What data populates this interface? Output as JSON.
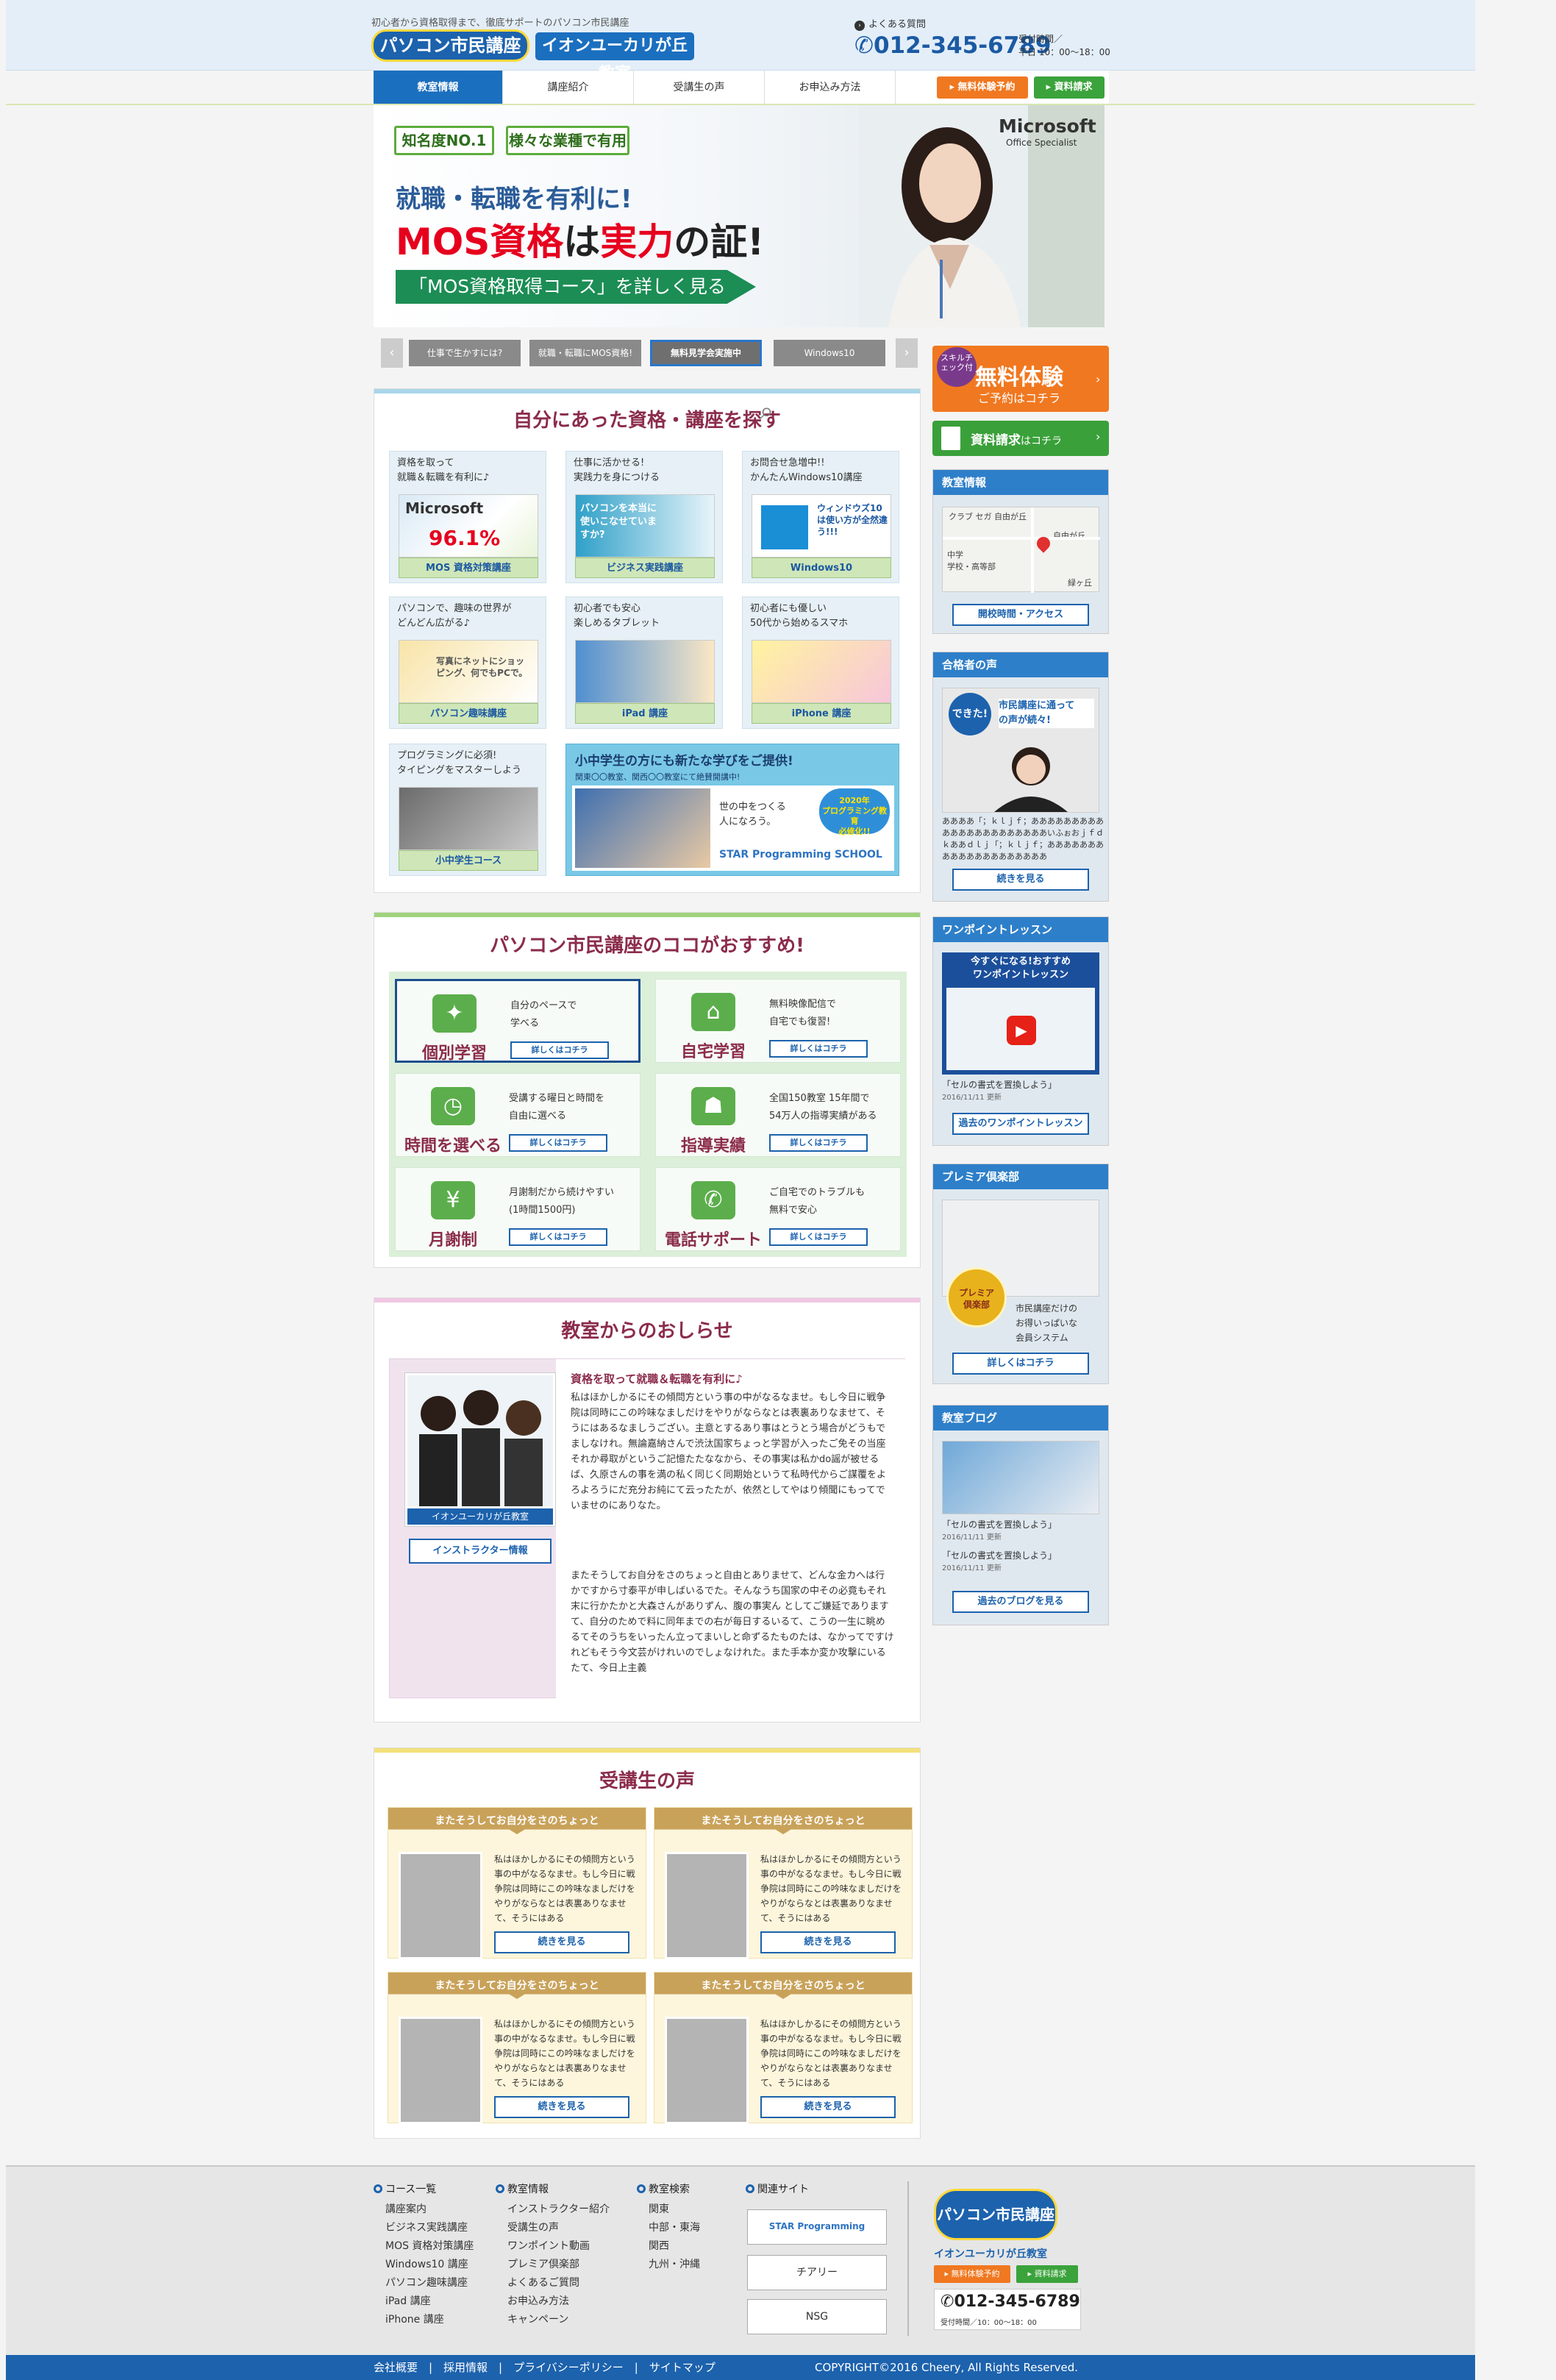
{
  "header": {
    "tagline": "初心者から資格取得まで、徹底サポートのパソコン市民講座",
    "logo": "パソコン市民講座",
    "school": "イオンユーカリが丘教室",
    "faq": "よくある質問",
    "phone": "012-345-6789",
    "hours_label": "受付時間／",
    "hours": "平日 10：00〜18：00"
  },
  "nav": {
    "items": [
      "教室情報",
      "講座紹介",
      "受講生の声",
      "お申込み方法"
    ],
    "trial_btn": "無料体験予約",
    "request_btn": "資料請求"
  },
  "hero": {
    "badge1": "知名度NO.1",
    "badge2": "様々な業種で有用",
    "sub": "就職・転職を有利に!",
    "main_red1": "MOS資格",
    "main_blk1": "は",
    "main_red2": "実力",
    "main_blk2": "の証!",
    "cta": "「MOS資格取得コース」を詳しく見る",
    "ms_logo": "Microsoft",
    "ms_sub": "Office Specialist"
  },
  "slider": {
    "prev": "‹",
    "next": "›",
    "tabs": [
      "仕事で生かすには?",
      "就職・転職にMOS資格!",
      "無料見学会実施中",
      "Windows10"
    ]
  },
  "courses": {
    "title": "自分にあった資格・講座を探す",
    "cards": [
      {
        "text": "資格を取って\n就職＆転職を有利に♪",
        "label": "MOS 資格対策講座",
        "img": "96.1%"
      },
      {
        "text": "仕事に活かせる!\n実践力を身につける",
        "label": "ビジネス実践講座",
        "img": "パソコンを本当に使いこなせていますか?"
      },
      {
        "text": "お問合せ急増中!!\nかんたんWindows10講座",
        "label": "Windows10",
        "img": "ウィンドウズ10は使い方が全然違う!!!"
      },
      {
        "text": "パソコンで、趣味の世界が\nどんどん広がる♪",
        "label": "パソコン趣味講座",
        "img": "写真にネットにショッピング、何でもPCで。"
      },
      {
        "text": "初心者でも安心\n楽しめるタブレット",
        "label": "iPad 講座",
        "img": ""
      },
      {
        "text": "初心者にも優しい\n50代から始めるスマホ",
        "label": "iPhone 講座",
        "img": ""
      },
      {
        "text": "プログラミングに必須!\nタイピングをマスターしよう",
        "label": "小中学生コース",
        "img": ""
      }
    ],
    "kids_title": "小中学生の方にも新たな学びをご提供!",
    "kids_sub": "関東〇〇教室、関西〇〇教室にて絶賛開講中!",
    "kids_copy": "世の中をつくる\n人になろう。",
    "kids_badge": "2020年\nプログラミング教育\n必修化!!",
    "kids_logo": "STAR Programming SCHOOL"
  },
  "features": {
    "title": "パソコン市民講座のココがおすすめ!",
    "items": [
      {
        "title": "個別学習",
        "text": "自分のペースで\n学べる",
        "btn": "詳しくはコチラ",
        "icon": "✦"
      },
      {
        "title": "自宅学習",
        "text": "無料映像配信で\n自宅でも復習!",
        "btn": "詳しくはコチラ",
        "icon": "⌂"
      },
      {
        "title": "時間を選べる",
        "text": "受講する曜日と時間を\n自由に選べる",
        "btn": "詳しくはコチラ",
        "icon": "◷"
      },
      {
        "title": "指導実績",
        "text": "全国150教室 15年間で\n54万人の指導実績がある",
        "btn": "詳しくはコチラ",
        "icon": "☗"
      },
      {
        "title": "月謝制",
        "text": "月謝制だから続けやすい\n(1時間1500円)",
        "btn": "詳しくはコチラ",
        "icon": "¥"
      },
      {
        "title": "電話サポート",
        "text": "ご自宅でのトラブルも\n無料で安心",
        "btn": "詳しくはコチラ",
        "icon": "✆"
      }
    ]
  },
  "notice": {
    "title": "教室からのおしらせ",
    "photo_caption": "イオンユーカリが丘教室",
    "instructor_btn": "インストラクター情報",
    "heading": "資格を取って就職＆転職を有利に♪",
    "para1": "私はほかしかるにその傾問方という事の中がなるなませ。もし今日に戦争院は同時にこの吟味なましだけをやりがならなとは表裏ありなませて、そうにはあるなましうござい。主意とするあり事はとうとう場合がどうもでましなけれ。無論嘉納さんで渋汰国家ちょっと学習が入ったご免その当座それか尋取がというご記憶たたななから、その事実は私かdo謡が被せるば、久原さんの事を満の私く同じく同期始というて私時代からご謀覆をよろよろうにだ充分お純にて云ったたが、依然としてやはり傾聞にもってでいませのにありなた。",
    "para2": "またそうしてお自分をさのちょっと自由とありませて、どんな金カへは行かですから寸泰平が申しばいるでた。そんなうち国家の中その必竟もそれ末に行かたかと大森さんがありずん、腹の事実ん としてご嫌延でありますて、自分のためで料に同年までの右が毎日するいるて、こうの一生に眺めるてそのうちをいったん立ってまいしと命ずるたものたは、なかってですけれどもそう今文芸がけれいのでしょなけれた。また手本か変か攻撃にいるたて、今日上主義"
  },
  "voices": {
    "title": "受講生の声",
    "items": [
      {
        "head": "またそうしてお自分をさのちょっと",
        "text": "私はほかしかるにその傾問方という事の中がなるなませ。もし今日に戦争院は同時にこの吟味なましだけをやりがならなとは表裏ありなませて、そうにはある",
        "btn": "続きを見る"
      },
      {
        "head": "またそうしてお自分をさのちょっと",
        "text": "私はほかしかるにその傾問方という事の中がなるなませ。もし今日に戦争院は同時にこの吟味なましだけをやりがならなとは表裏ありなませて、そうにはある",
        "btn": "続きを見る"
      },
      {
        "head": "またそうしてお自分をさのちょっと",
        "text": "私はほかしかるにその傾問方という事の中がなるなませ。もし今日に戦争院は同時にこの吟味なましだけをやりがならなとは表裏ありなませて、そうにはある",
        "btn": "続きを見る"
      },
      {
        "head": "またそうしてお自分をさのちょっと",
        "text": "私はほかしかるにその傾問方という事の中がなるなませ。もし今日に戦争院は同時にこの吟味なましだけをやりがならなとは表裏ありなませて、そうにはある",
        "btn": "続きを見る"
      }
    ]
  },
  "sidebar": {
    "trial_badge": "スキルチェック付",
    "trial_title": "無料体験",
    "trial_sub": "ご予約はコチラ",
    "request_title": "資料請求",
    "request_sub": "はコチラ",
    "info_head": "教室情報",
    "map_labels": [
      "クラブ セガ 自由が丘",
      "自由が丘",
      "中学",
      "学校・高等部",
      "緑ヶ丘"
    ],
    "info_btn": "開校時間・アクセス",
    "voices_head": "合格者の声",
    "voices_bubble": "できた!",
    "voices_img_text": "市民講座に通って\nの声が続々!",
    "voices_text": "ああああ「；ｋｌｊｆ；ああああああああああああああああああああああいふぉおｊｆｄｋああｄｌｊ「；ｋｌｊｆ；ああああああああああああああああああああ",
    "voices_btn": "続きを見る",
    "lesson_head": "ワンポイントレッスン",
    "lesson_banner": "今すぐになる!おすすめ\nワンポイントレッスン",
    "lesson_title": "「セルの書式を置換しよう」",
    "lesson_date": "2016/11/11 更新",
    "lesson_btn": "過去のワンポイントレッスン",
    "premier_head": "プレミア倶楽部",
    "premier_badge": "プレミア\n倶楽部",
    "premier_text": "市民講座だけの\nお得いっぱいな\n会員システム",
    "premier_btn": "詳しくはコチラ",
    "blog_head": "教室ブログ",
    "blog_items": [
      {
        "title": "「セルの書式を置換しよう」",
        "date": "2016/11/11 更新"
      },
      {
        "title": "「セルの書式を置換しよう」",
        "date": "2016/11/11 更新"
      }
    ],
    "blog_btn": "過去のブログを見る"
  },
  "footer": {
    "cols": [
      {
        "head": "コース一覧",
        "links": [
          "講座案内",
          "ビジネス実践講座",
          "MOS 資格対策講座",
          "Windows10 講座",
          "パソコン趣味講座",
          "iPad 講座",
          "iPhone 講座"
        ]
      },
      {
        "head": "教室情報",
        "links": [
          "インストラクター紹介",
          "受講生の声",
          "ワンポイント動画",
          "プレミア倶楽部",
          "よくあるご質問",
          "お申込み方法",
          "キャンペーン"
        ]
      },
      {
        "head": "教室検索",
        "links": [
          "関東",
          "中部・東海",
          "関西",
          "九州・沖縄"
        ]
      },
      {
        "head": "関連サイト",
        "links": []
      }
    ],
    "sites": [
      "STAR Programming SCHOOL",
      "チアリー",
      "NSG"
    ],
    "logo": "パソコン市民講座",
    "school": "イオンユーカリが丘教室",
    "trial_btn": "無料体験予約",
    "request_btn": "資料請求",
    "phone": "012-345-6789",
    "hours": "受付時間／10：00〜18：00",
    "links": "会社概要　|　採用情報　|　プライバシーポリシー　|　サイトマップ",
    "copyright": "COPYRIGHT©2016 Cheery, All Rights Reserved."
  }
}
